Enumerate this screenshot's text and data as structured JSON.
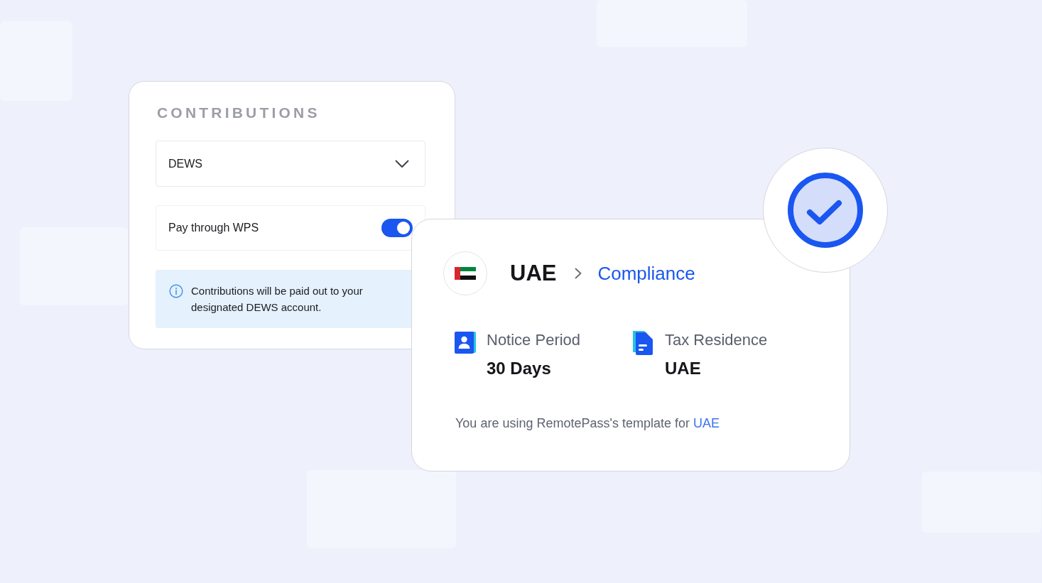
{
  "contributions": {
    "heading": "CONTRIBUTIONS",
    "dropdown": {
      "value": "DEWS"
    },
    "toggle": {
      "label": "Pay through WPS",
      "on": true
    },
    "info": {
      "text": "Contributions will be paid out to your designated DEWS account."
    }
  },
  "compliance_card": {
    "country": "UAE",
    "section": "Compliance",
    "fields": [
      {
        "kind": "person",
        "label": "Notice Period",
        "value": "30 Days"
      },
      {
        "kind": "document",
        "label": "Tax Residence",
        "value": "UAE"
      }
    ],
    "footer": {
      "text": "You are using RemotePass's template for",
      "link": "UAE"
    }
  }
}
